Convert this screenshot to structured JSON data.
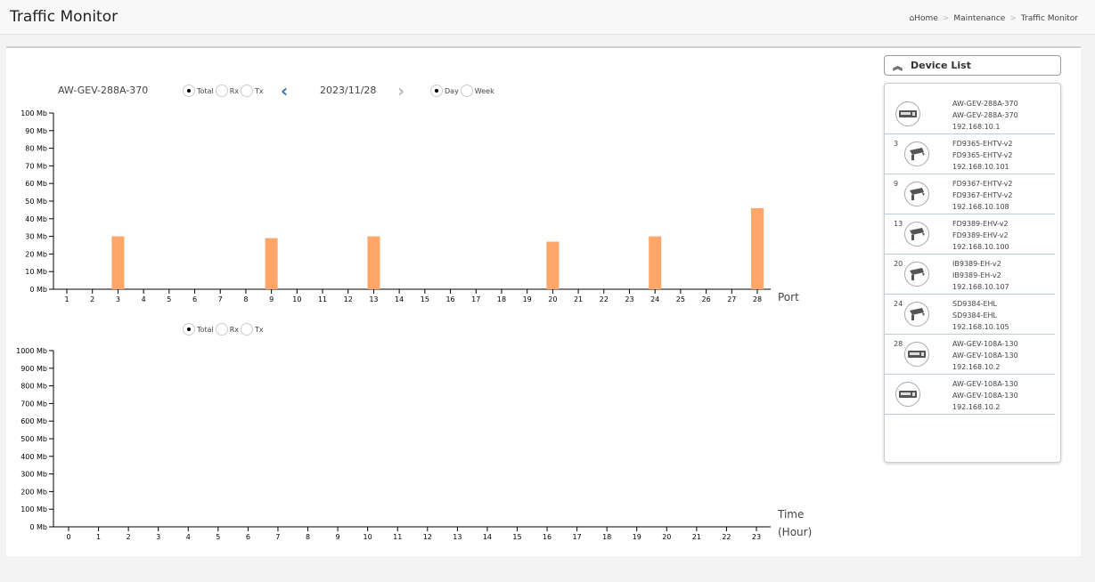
{
  "header": {
    "title": "Traffic Monitor",
    "breadcrumb": [
      "Home",
      "Maintenance",
      "Traffic Monitor"
    ]
  },
  "controls": {
    "device": "AW-GEV-288A-370",
    "metric_options": [
      "Total",
      "Rx",
      "Tx"
    ],
    "metric_selected": "Total",
    "date": "2023/11/28",
    "period_options": [
      "Day",
      "Week"
    ],
    "period_selected": "Day"
  },
  "device_list": {
    "title": "Device List",
    "items": [
      {
        "port": "",
        "icon": "switch-icon",
        "model": "AW-GEV-288A-370",
        "name": "AW-GEV-288A-370",
        "ip": "192.168.10.1"
      },
      {
        "port": "3",
        "icon": "camera-icon",
        "model": "FD9365-EHTV-v2",
        "name": "FD9365-EHTV-v2",
        "ip": "192.168.10.101"
      },
      {
        "port": "9",
        "icon": "camera-icon",
        "model": "FD9367-EHTV-v2",
        "name": "FD9367-EHTV-v2",
        "ip": "192.168.10.108"
      },
      {
        "port": "13",
        "icon": "camera-icon",
        "model": "FD9389-EHV-v2",
        "name": "FD9389-EHV-v2",
        "ip": "192.168.10.100"
      },
      {
        "port": "20",
        "icon": "camera-icon",
        "model": "IB9389-EH-v2",
        "name": "IB9389-EH-v2",
        "ip": "192.168.10.107"
      },
      {
        "port": "24",
        "icon": "camera-icon",
        "model": "SD9384-EHL",
        "name": "SD9384-EHL",
        "ip": "192.168.10.105"
      },
      {
        "port": "28",
        "icon": "switch-icon",
        "model": "AW-GEV-108A-130",
        "name": "AW-GEV-108A-130",
        "ip": "192.168.10.2"
      },
      {
        "port": "",
        "icon": "switch-icon",
        "model": "AW-GEV-108A-130",
        "name": "AW-GEV-108A-130",
        "ip": "192.168.10.2"
      }
    ]
  },
  "chart_data": [
    {
      "type": "bar",
      "xlabel": "Port",
      "ylabel": "",
      "ylim": [
        0,
        100
      ],
      "yticks": [
        "0 Mb",
        "10 Mb",
        "20 Mb",
        "30 Mb",
        "40 Mb",
        "50 Mb",
        "60 Mb",
        "70 Mb",
        "80 Mb",
        "90 Mb",
        "100 Mb"
      ],
      "categories": [
        "1",
        "2",
        "3",
        "4",
        "5",
        "6",
        "7",
        "8",
        "9",
        "10",
        "11",
        "12",
        "13",
        "14",
        "15",
        "16",
        "17",
        "18",
        "19",
        "20",
        "21",
        "22",
        "23",
        "24",
        "25",
        "26",
        "27",
        "28"
      ],
      "values": [
        0,
        0,
        30,
        0,
        0,
        0,
        0,
        0,
        29,
        0,
        0,
        0,
        30,
        0,
        0,
        0,
        0,
        0,
        0,
        27,
        0,
        0,
        0,
        30,
        0,
        0,
        0,
        46
      ],
      "color": "#ffa668"
    },
    {
      "type": "line",
      "xlabel": "Time (Hour)",
      "xlabel_lines": [
        "Time",
        "(Hour)"
      ],
      "ylim": [
        0,
        1000
      ],
      "yticks": [
        "0 Mb",
        "100 Mb",
        "200 Mb",
        "300 Mb",
        "400 Mb",
        "500 Mb",
        "600 Mb",
        "700 Mb",
        "800 Mb",
        "900 Mb",
        "1000 Mb"
      ],
      "categories": [
        "0",
        "1",
        "2",
        "3",
        "4",
        "5",
        "6",
        "7",
        "8",
        "9",
        "10",
        "11",
        "12",
        "13",
        "14",
        "15",
        "16",
        "17",
        "18",
        "19",
        "20",
        "21",
        "22",
        "23"
      ],
      "values": [],
      "metric_options": [
        "Total",
        "Rx",
        "Tx"
      ],
      "metric_selected": "Total"
    }
  ]
}
